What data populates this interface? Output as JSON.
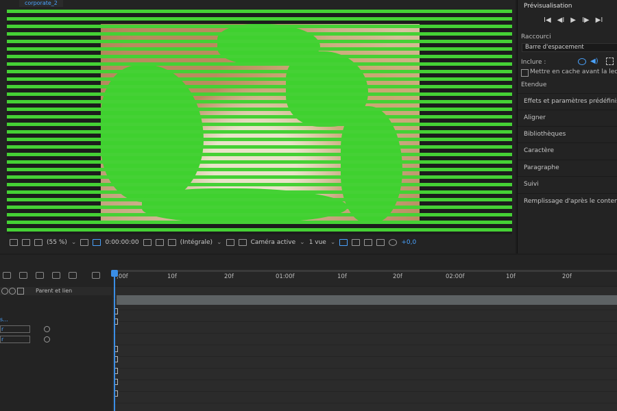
{
  "comp_tab": "corporate_2",
  "viewer_toolbar": {
    "zoom": "(55 %)",
    "timecode": "0:00:00:00",
    "resolution": "(Intégrale)",
    "camera": "Caméra active",
    "views": "1 vue",
    "exposure": "+0,0"
  },
  "preview": {
    "title": "Prévisualisation",
    "controls": [
      "I◀",
      "◀I",
      "▶",
      "I▶",
      "▶I"
    ],
    "shortcut_label": "Raccourci",
    "shortcut_value": "Barre d'espacement",
    "include_label": "Inclure :",
    "cache_label": "Mettre en cache avant la lecture",
    "range_label": "Etendue"
  },
  "panels": [
    "Effets et paramètres prédéfinis",
    "Aligner",
    "Bibliothèques",
    "Caractère",
    "Paragraphe",
    "Suivi",
    "Remplissage d'après le contenu"
  ],
  "timeline": {
    "parent_label": "Parent et lien",
    "ruler_ticks": [
      ";00f",
      "10f",
      "20f",
      "01:00f",
      "10f",
      "20f",
      "02:00f",
      "10f",
      "20f"
    ],
    "layer_fragment": "s...",
    "prop_values": [
      "r",
      "r"
    ]
  },
  "colors": {
    "accent_blue": "#4aa3ff",
    "chroma_green": "#45d135"
  }
}
